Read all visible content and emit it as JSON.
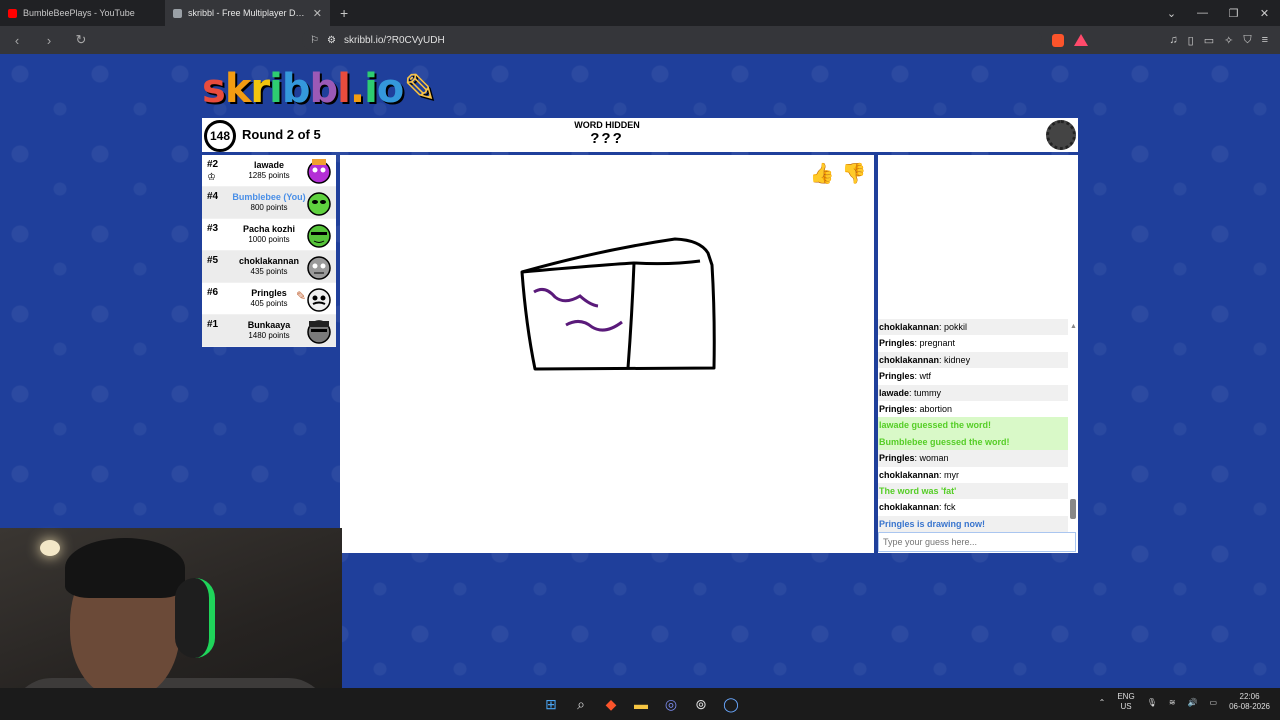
{
  "browser": {
    "tabs": [
      {
        "title": "BumbleBeePlays - YouTube",
        "active": false,
        "favicon_color": "#ff0000"
      },
      {
        "title": "skribbl - Free Multiplayer Drawing",
        "active": true,
        "favicon_color": "#9aa0a6"
      }
    ],
    "new_tab": "+",
    "url": "skribbl.io/?R0CVyUDH"
  },
  "game": {
    "logo": "skribbl.io",
    "timer": "148",
    "round": "Round 2 of 5",
    "word_label": "WORD HIDDEN",
    "word": "???"
  },
  "players": [
    {
      "rank": "#2",
      "name": "lawade",
      "points": "1285 points",
      "you": false,
      "avatar_color": "#b42fd6",
      "crown": true
    },
    {
      "rank": "#4",
      "name": "Bumblebee (You)",
      "points": "800 points",
      "you": true,
      "avatar_color": "#5fd13f"
    },
    {
      "rank": "#3",
      "name": "Pacha kozhi",
      "points": "1000 points",
      "you": false,
      "avatar_color": "#56c43a"
    },
    {
      "rank": "#5",
      "name": "choklakannan",
      "points": "435 points",
      "you": false,
      "avatar_color": "#9a9a9a"
    },
    {
      "rank": "#6",
      "name": "Pringles",
      "points": "405 points",
      "you": false,
      "avatar_color": "#f0f0f0",
      "drawing": true
    },
    {
      "rank": "#1",
      "name": "Bunkaaya",
      "points": "1480 points",
      "you": false,
      "avatar_color": "#7a7a7a"
    }
  ],
  "chat": {
    "messages": [
      {
        "name": "choklakannan",
        "text": "pokkil",
        "type": "normal"
      },
      {
        "name": "Pringles",
        "text": "pregnant",
        "type": "normal"
      },
      {
        "name": "choklakannan",
        "text": "kidney",
        "type": "normal"
      },
      {
        "name": "Pringles",
        "text": "wtf",
        "type": "normal"
      },
      {
        "name": "lawade",
        "text": "tummy",
        "type": "normal"
      },
      {
        "name": "Pringles",
        "text": "abortion",
        "type": "normal"
      },
      {
        "name": "",
        "text": "lawade guessed the word!",
        "type": "guessed"
      },
      {
        "name": "",
        "text": "Bumblebee guessed the word!",
        "type": "guessed"
      },
      {
        "name": "Pringles",
        "text": "woman",
        "type": "normal"
      },
      {
        "name": "choklakannan",
        "text": "myr",
        "type": "normal"
      },
      {
        "name": "",
        "text": "The word was 'fat'",
        "type": "reveal"
      },
      {
        "name": "choklakannan",
        "text": "fck",
        "type": "normal"
      },
      {
        "name": "",
        "text": "Pringles is drawing now!",
        "type": "drawing"
      }
    ],
    "input_placeholder": "Type your guess here..."
  },
  "taskbar": {
    "lang_top": "ENG",
    "lang_bottom": "US",
    "time": "22:06",
    "date": "06-08-2026"
  },
  "colors": {
    "page_bg": "#1f3f9b",
    "guess_green": "#56ce27",
    "system_blue": "#3975ce",
    "you_blue": "#4a8fe7"
  }
}
